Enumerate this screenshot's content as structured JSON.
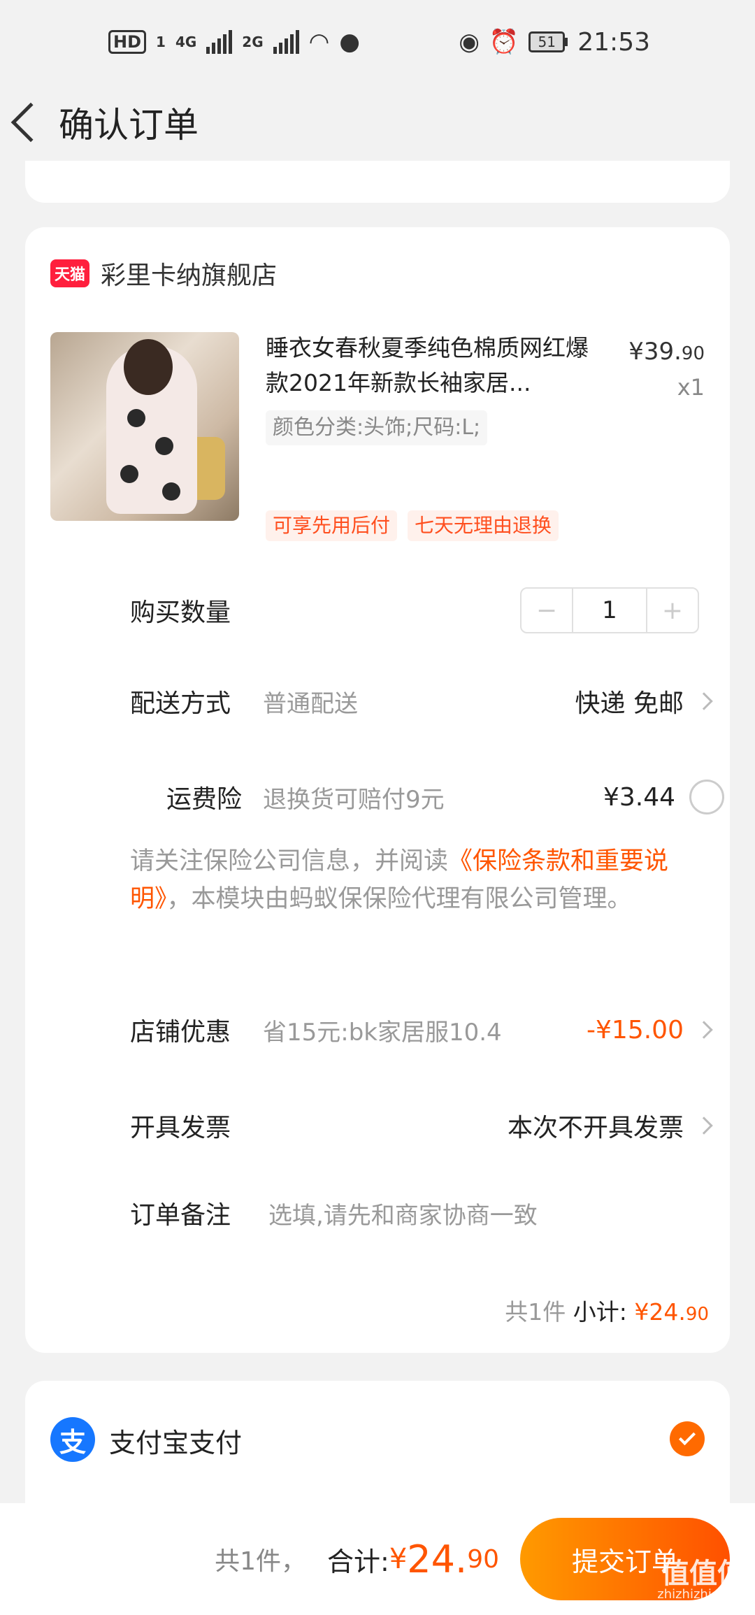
{
  "status": {
    "hd": "HD",
    "sim1": "1",
    "net1": "4G",
    "net2": "2G",
    "battery": "51",
    "time": "21:53"
  },
  "nav": {
    "title": "确认订单"
  },
  "shop": {
    "badge": "天猫",
    "name": "彩里卡纳旗舰店"
  },
  "product": {
    "title": "睡衣女春秋夏季纯色棉质网红爆款2021年新款长袖家居...",
    "price_int": "¥39.",
    "price_dec": "90",
    "qty": "x1",
    "sku": "颜色分类:头饰;尺码:L;",
    "tag1": "可享先用后付",
    "tag2": "七天无理由退换"
  },
  "purchase_qty": {
    "label": "购买数量",
    "minus": "−",
    "value": "1",
    "plus": "+"
  },
  "delivery": {
    "label": "配送方式",
    "sub": "普通配送",
    "value": "快递 免邮"
  },
  "insurance": {
    "label": "运费险",
    "sub": "退换货可赔付9元",
    "value": "¥3.44",
    "notice_pre": "请关注保险公司信息，并阅读",
    "notice_link": "《保险条款和重要说明》",
    "notice_post": "，本模块由蚂蚁保保险代理有限公司管理。"
  },
  "coupon": {
    "label": "店铺优惠",
    "sub": "省15元:bk家居服10.4",
    "value": "-¥15.00"
  },
  "invoice": {
    "label": "开具发票",
    "value": "本次不开具发票"
  },
  "remark": {
    "label": "订单备注",
    "placeholder": "选填,请先和商家协商一致"
  },
  "subtotal": {
    "count": "共1件",
    "label": "小计:",
    "amount": "¥24.",
    "dec": "90"
  },
  "payment": {
    "icon": "支",
    "label": "支付宝支付"
  },
  "bottom": {
    "count": "共1件，",
    "label": "合计:",
    "yen": "¥",
    "amount": "24.",
    "dec": "90",
    "submit": "提交订单"
  },
  "watermark": {
    "main": "值值值",
    "sub": "zhizhizhi.com"
  },
  "colors": {
    "accent": "#ff5500",
    "tmall": "#ff1f3d",
    "alipay": "#1677ff"
  }
}
